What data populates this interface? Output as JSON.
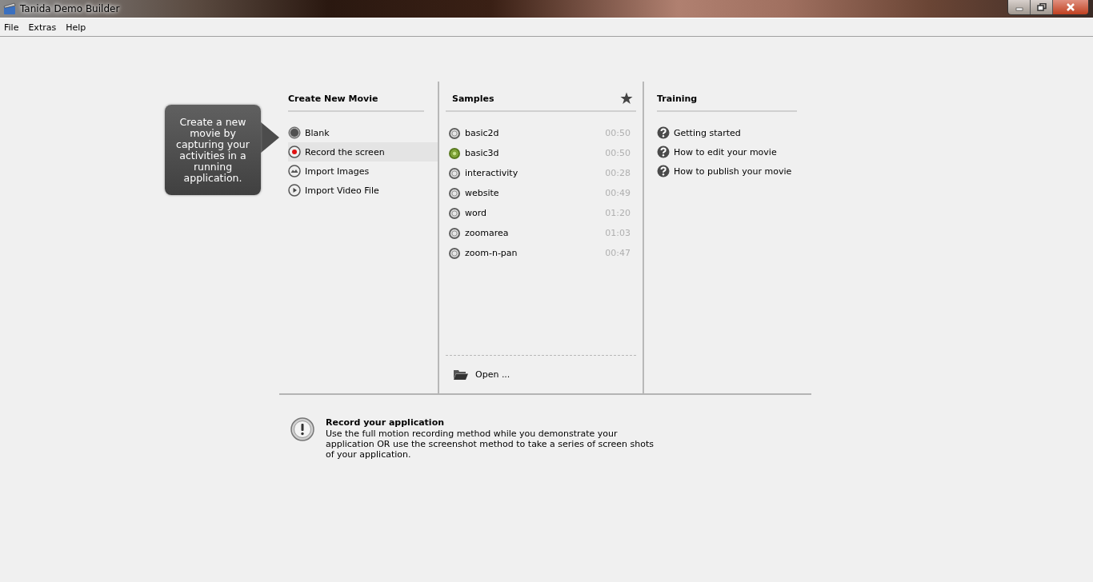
{
  "window": {
    "title": "Tanida Demo Builder"
  },
  "menu": [
    {
      "label": "File"
    },
    {
      "label": "Extras"
    },
    {
      "label": "Help"
    }
  ],
  "create": {
    "heading": "Create New Movie",
    "items": [
      {
        "label": "Blank",
        "kind": "blank",
        "selected": false
      },
      {
        "label": "Record the screen",
        "kind": "record",
        "selected": true
      },
      {
        "label": "Import Images",
        "kind": "images",
        "selected": false
      },
      {
        "label": "Import Video File",
        "kind": "video",
        "selected": false
      }
    ],
    "tooltip": "Create a new movie by capturing your activities in a running application."
  },
  "samples": {
    "heading": "Samples",
    "items": [
      {
        "name": "basic2d",
        "duration": "00:50",
        "selected": false
      },
      {
        "name": "basic3d",
        "duration": "00:50",
        "selected": true
      },
      {
        "name": "interactivity",
        "duration": "00:28",
        "selected": false
      },
      {
        "name": "website",
        "duration": "00:49",
        "selected": false
      },
      {
        "name": "word",
        "duration": "01:20",
        "selected": false
      },
      {
        "name": "zoomarea",
        "duration": "01:03",
        "selected": false
      },
      {
        "name": "zoom-n-pan",
        "duration": "00:47",
        "selected": false
      }
    ],
    "open": "Open ..."
  },
  "training": {
    "heading": "Training",
    "items": [
      {
        "label": "Getting started"
      },
      {
        "label": "How to edit your movie"
      },
      {
        "label": "How to publish your movie"
      }
    ]
  },
  "info": {
    "title": "Record your application",
    "text": "Use the full motion recording method while you demonstrate your application OR use the screenshot method to take a series of screen shots of your application."
  }
}
